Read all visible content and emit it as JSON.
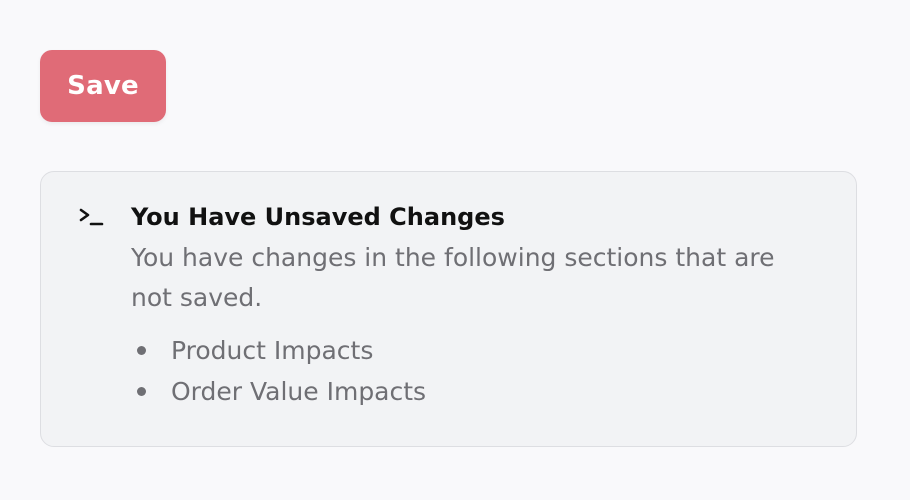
{
  "toolbar": {
    "save_label": "Save"
  },
  "alert": {
    "icon": "terminal-icon",
    "title": "You Have Unsaved Changes",
    "description": "You have changes in the following sections that are not saved.",
    "sections": [
      "Product Impacts",
      "Order Value Impacts"
    ]
  },
  "colors": {
    "background": "#f9f9fb",
    "save_button": "#e06b77",
    "alert_background": "#f2f3f5",
    "alert_border": "#dddee2",
    "muted_text": "#6f6f74"
  }
}
